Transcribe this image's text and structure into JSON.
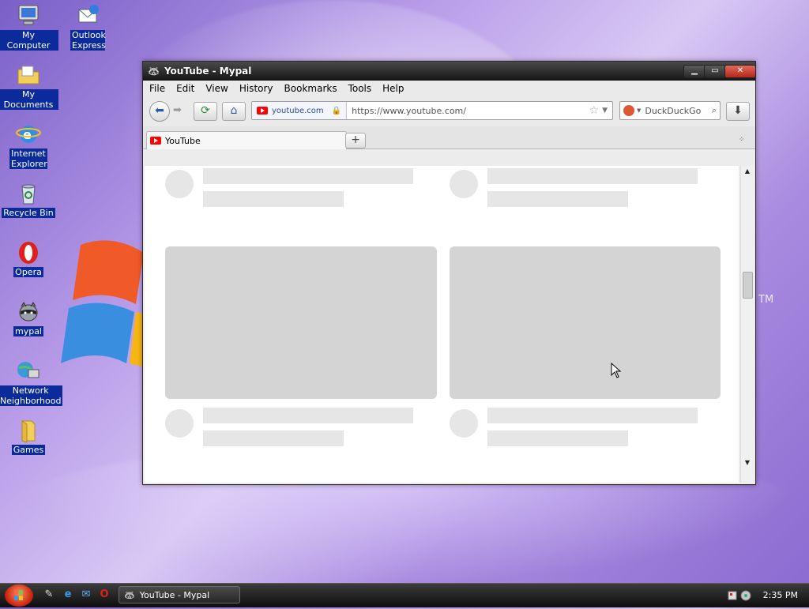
{
  "desktop": {
    "icons": [
      {
        "label": "My Computer",
        "icon": "computer-icon"
      },
      {
        "label": "Outlook Express",
        "icon": "outlook-icon"
      },
      {
        "label": "My Documents",
        "icon": "folder-documents-icon"
      },
      {
        "label": "Internet Explorer",
        "icon": "ie-icon"
      },
      {
        "label": "Recycle Bin",
        "icon": "recycle-bin-icon"
      },
      {
        "label": "Opera",
        "icon": "opera-icon"
      },
      {
        "label": "mypal",
        "icon": "mypal-raccoon-icon"
      },
      {
        "label": "Network Neighborhood",
        "icon": "network-icon"
      },
      {
        "label": "Games",
        "icon": "games-folder-icon"
      }
    ],
    "wallpaper_tm": "TM"
  },
  "window": {
    "title": "YouTube - Mypal",
    "controls": {
      "minimize": "▁",
      "maximize": "▭",
      "close": "✕"
    },
    "menu": [
      "File",
      "Edit",
      "View",
      "History",
      "Bookmarks",
      "Tools",
      "Help"
    ],
    "nav": {
      "site_identity": "youtube.com",
      "url": "https://www.youtube.com/",
      "search_engine": "DuckDuckGo"
    },
    "tabs": [
      {
        "title": "YouTube",
        "active": true
      }
    ],
    "new_tab_label": "+"
  },
  "taskbar": {
    "task_button": "YouTube - Mypal",
    "clock": "2:35 PM"
  },
  "colors": {
    "youtube_red": "#ff0000",
    "title_bar": "#1a1a1a",
    "placeholder": "#e6e6e6",
    "placeholder_dark": "#d4d4d4"
  }
}
